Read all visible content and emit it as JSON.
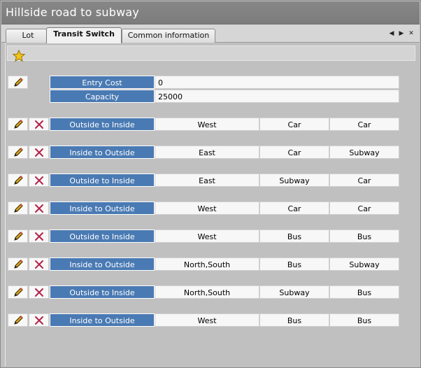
{
  "window": {
    "title": "Hillside road to subway"
  },
  "tabs": [
    {
      "label": "Lot",
      "active": false
    },
    {
      "label": "Transit Switch",
      "active": true
    },
    {
      "label": "Common information",
      "active": false
    }
  ],
  "toolbar": {
    "icon": "star-icon"
  },
  "properties": [
    {
      "label": "Entry Cost",
      "value": "0"
    },
    {
      "label": "Capacity",
      "value": "25000"
    }
  ],
  "switches": [
    {
      "direction": "Outside to Inside",
      "side": "West",
      "from": "Car",
      "to": "Car"
    },
    {
      "direction": "Inside to Outside",
      "side": "East",
      "from": "Car",
      "to": "Subway"
    },
    {
      "direction": "Outside to Inside",
      "side": "East",
      "from": "Subway",
      "to": "Car"
    },
    {
      "direction": "Inside to Outside",
      "side": "West",
      "from": "Car",
      "to": "Car"
    },
    {
      "direction": "Outside to Inside",
      "side": "West",
      "from": "Bus",
      "to": "Bus"
    },
    {
      "direction": "Inside to Outside",
      "side": "North,South",
      "from": "Bus",
      "to": "Subway"
    },
    {
      "direction": "Outside to Inside",
      "side": "North,South",
      "from": "Subway",
      "to": "Bus"
    },
    {
      "direction": "Inside to Outside",
      "side": "West",
      "from": "Bus",
      "to": "Bus"
    }
  ],
  "colors": {
    "label_bg": "#4a7ab3",
    "title_bar": "#808080",
    "delete_x": "#b3224a",
    "star": "#f2c318"
  }
}
